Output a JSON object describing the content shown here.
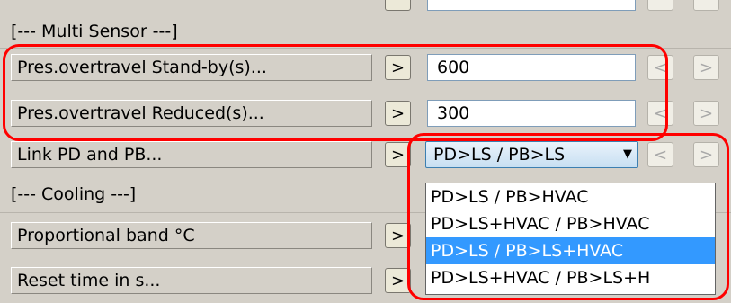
{
  "rows": {
    "section_multi_sensor": "[--- Multi Sensor ---]",
    "standby_label": "Pres.overtravel Stand-by(s)...",
    "standby_value": "600",
    "reduced_label": "Pres.overtravel Reduced(s)...",
    "reduced_value": "300",
    "link_label": "Link PD and PB...",
    "link_value": "PD>LS / PB>LS",
    "section_cooling": "[--- Cooling ---]",
    "prop_band_label": "Proportional band °C",
    "reset_time_label": "Reset time in s..."
  },
  "dropdown": {
    "options": [
      "PD>LS / PB>HVAC",
      "PD>LS+HVAC / PB>HVAC",
      "PD>LS / PB>LS+HVAC",
      "PD>LS+HVAC / PB>LS+H"
    ],
    "selected_index": 2
  },
  "glyphs": {
    "go": ">",
    "prev": "<",
    "next": ">",
    "arrow": "▼"
  },
  "colors": {
    "highlight": "#ff0000",
    "selection": "#3399ff",
    "panel": "#d4d0c8"
  }
}
